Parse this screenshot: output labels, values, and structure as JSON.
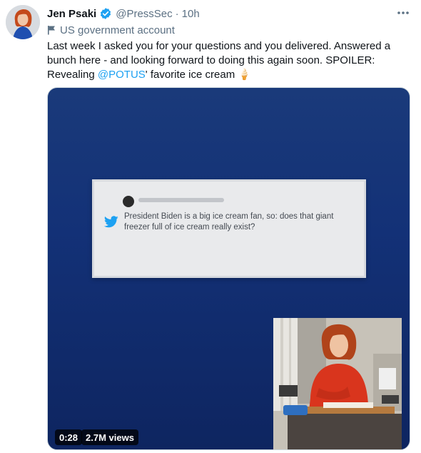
{
  "tweet": {
    "author": {
      "name": "Jen Psaki",
      "handle": "@PressSec",
      "separator": "·",
      "time": "10h",
      "verified": true,
      "label": "US government account"
    },
    "text": {
      "before_mention": "Last week I asked you for your questions and you delivered. Answered a bunch here - and looking forward to doing this again soon. SPOILER: Revealing ",
      "mention": "@POTUS",
      "after_mention": "' favorite ice cream",
      "emoji": "🍦"
    },
    "media": {
      "embedded_tweet_text": "President Biden is a big ice cream fan, so: does that giant freezer full of ice cream really exist?",
      "duration": "0:28",
      "views": "2.7M views"
    }
  },
  "icons": {
    "verified": "verified-badge-icon",
    "more": "more-options-icon",
    "label": "flag-icon",
    "embedded_bird": "twitter-bird-icon"
  },
  "colors": {
    "accent": "#1da1f2",
    "muted_text": "#5b7083",
    "media_background": "#133177"
  }
}
